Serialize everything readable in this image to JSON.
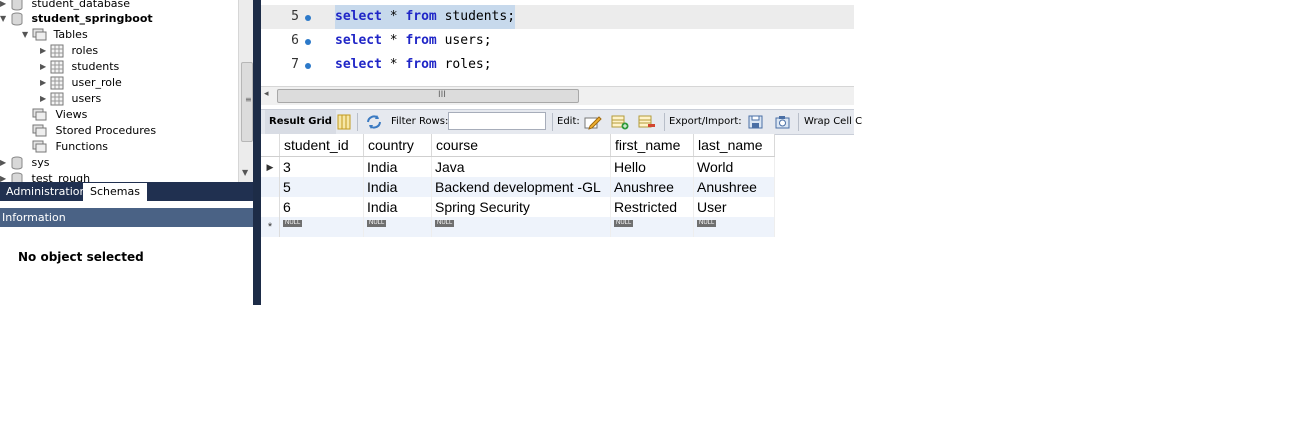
{
  "tree": {
    "items": [
      {
        "label": "student_database",
        "type": "schema"
      },
      {
        "label": "student_springboot",
        "type": "schema"
      },
      {
        "label": "Tables",
        "type": "folder"
      },
      {
        "label": "roles",
        "type": "table"
      },
      {
        "label": "students",
        "type": "table"
      },
      {
        "label": "user_role",
        "type": "table"
      },
      {
        "label": "users",
        "type": "table"
      },
      {
        "label": "Views",
        "type": "folder"
      },
      {
        "label": "Stored Procedures",
        "type": "folder"
      },
      {
        "label": "Functions",
        "type": "folder"
      },
      {
        "label": "sys",
        "type": "schema"
      },
      {
        "label": "test_rough",
        "type": "schema"
      }
    ]
  },
  "sidebar_tabs": {
    "administration": "Administration",
    "schemas": "Schemas"
  },
  "information": {
    "header": "Information",
    "message": "No object selected"
  },
  "editor": {
    "lines": [
      {
        "num": "5",
        "kw1": "select",
        "mid": " * ",
        "kw2": "from",
        "rest": " students;"
      },
      {
        "num": "6",
        "kw1": "select",
        "mid": " * ",
        "kw2": "from",
        "rest": " users;"
      },
      {
        "num": "7",
        "kw1": "select",
        "mid": " * ",
        "kw2": "from",
        "rest": " roles;"
      }
    ]
  },
  "result_toolbar": {
    "result_grid": "Result Grid",
    "filter_rows": "Filter Rows:",
    "filter_value": "",
    "edit": "Edit:",
    "export_import": "Export/Import:",
    "wrap": "Wrap Cell C"
  },
  "grid": {
    "columns": [
      "student_id",
      "country",
      "course",
      "first_name",
      "last_name"
    ],
    "rows": [
      [
        "3",
        "India",
        "Java",
        "Hello",
        "World"
      ],
      [
        "5",
        "India",
        "Backend development -GL",
        "Anushree",
        "Anushree"
      ],
      [
        "6",
        "India",
        "Spring Security",
        "Restricted",
        "User"
      ]
    ],
    "null_label": "NULL",
    "new_row_marker": "*"
  },
  "colors": {
    "keyword": "#2026c7",
    "selection": "#c7d9ec",
    "sidebar_dark": "#203050",
    "info_header": "#4a6285"
  }
}
